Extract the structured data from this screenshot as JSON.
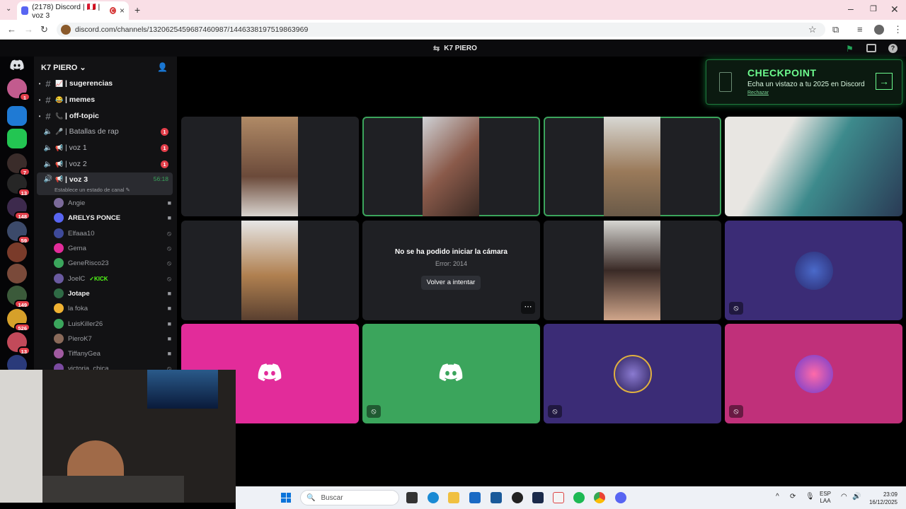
{
  "browser": {
    "tab_title": "(2178) Discord | 🇵🇪 | voz 3",
    "tab_close": "×",
    "new_tab": "+",
    "url": "discord.com/channels/1320625459687460987/1446338197519863969"
  },
  "discord": {
    "call_title": "K7 PIERO",
    "server_name": "K7 PIERO",
    "servers": [
      {
        "badge": "1"
      },
      {
        "badge": ""
      },
      {
        "badge": ""
      },
      {
        "badge": "7"
      },
      {
        "badge": "13"
      },
      {
        "badge": "148"
      },
      {
        "badge": "59"
      },
      {
        "badge": ""
      },
      {
        "badge": ""
      },
      {
        "badge": "149"
      },
      {
        "badge": "526"
      },
      {
        "badge": "13"
      },
      {
        "badge": ""
      }
    ],
    "channels": [
      {
        "type": "text",
        "emoji": "📈",
        "name": "| sugerencias",
        "count": ""
      },
      {
        "type": "text",
        "emoji": "😂",
        "name": "| memes",
        "count": ""
      },
      {
        "type": "text",
        "emoji": "📞",
        "name": "| off-topic",
        "count": ""
      },
      {
        "type": "voice",
        "emoji": "🎤",
        "name": "| Batallas de rap",
        "count": "1"
      },
      {
        "type": "voice",
        "emoji": "📢",
        "name": "| voz 1",
        "count": "1"
      },
      {
        "type": "voice",
        "emoji": "📢",
        "name": "| voz 2",
        "count": "1"
      },
      {
        "type": "voice",
        "emoji": "📢",
        "name": "| voz 3",
        "count": "",
        "timer": "56:18"
      }
    ],
    "channel_status": "Establece un estado de canal",
    "users": [
      {
        "name": "Angie",
        "icon": "video-icon"
      },
      {
        "name": "ARELYS PONCE",
        "icon": "video-icon"
      },
      {
        "name": "Elfaaa10",
        "icon": "mic-muted-icon"
      },
      {
        "name": "Gema",
        "icon": "mic-muted-icon"
      },
      {
        "name": "GeneRisco23",
        "icon": "mic-muted-icon"
      },
      {
        "name": "JoelC",
        "tag": "KICK",
        "icon": "mic-muted-icon"
      },
      {
        "name": "Jotape",
        "icon": "video-icon"
      },
      {
        "name": "la foka",
        "icon": "video-icon"
      },
      {
        "name": "LuisKiller26",
        "icon": "video-icon"
      },
      {
        "name": "PieroK7",
        "icon": "video-icon"
      },
      {
        "name": "TiffanyGea",
        "icon": "video-icon"
      },
      {
        "name": "victoria_chica",
        "icon": "mic-muted-icon"
      }
    ],
    "camera_error": {
      "title": "No se ha podido iniciar la cámara",
      "code": "Error: 2014",
      "retry": "Volver a intentar",
      "more": "⋯"
    },
    "banner": {
      "title": "CHECKPOINT",
      "subtitle": "Echa un vistazo a tu 2025 en Discord",
      "dismiss": "Rechazar"
    },
    "colors": {
      "accent": "#5865f2",
      "speaking": "#3ba55c",
      "badge": "#e23e4a",
      "pink": "#e22c9a",
      "green": "#3ba55c",
      "purple": "#3b2c76"
    }
  },
  "taskbar": {
    "search_placeholder": "Buscar",
    "lang_1": "ESP",
    "lang_2": "LAA",
    "time": "23:09",
    "date": "16/12/2025"
  }
}
